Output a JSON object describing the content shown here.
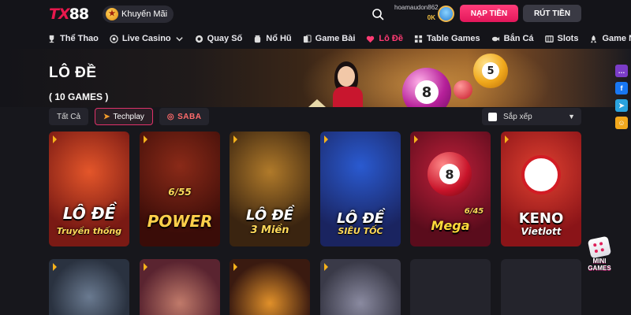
{
  "header": {
    "logo_text_left": "TX",
    "logo_text_right": "88",
    "promo_label": "Khuyến Mãi",
    "username": "hoamaudon862",
    "balance": "0K",
    "deposit_label": "NẠP TIỀN",
    "withdraw_label": "RÚT TIỀN"
  },
  "nav": {
    "items": [
      {
        "label": "Thể Thao",
        "icon": "trophy-icon"
      },
      {
        "label": "Live Casino",
        "icon": "casino-chip-icon"
      },
      {
        "label": "Quay Số",
        "icon": "lottery-ball-icon"
      },
      {
        "label": "Nổ Hũ",
        "icon": "jar-icon"
      },
      {
        "label": "Game Bài",
        "icon": "cards-icon"
      },
      {
        "label": "Lô Đề",
        "icon": "heart-lotto-icon",
        "active": true
      },
      {
        "label": "Table Games",
        "icon": "table-icon"
      },
      {
        "label": "Bắn Cá",
        "icon": "fish-icon"
      },
      {
        "label": "Slots",
        "icon": "slot-machine-icon"
      },
      {
        "label": "Game Nhanh",
        "icon": "rocket-icon"
      }
    ]
  },
  "hero": {
    "title": "LÔ ĐỀ",
    "count": "( 10 GAMES )",
    "balls": [
      "8",
      "5"
    ]
  },
  "filters": {
    "all": "Tất Cả",
    "techplay": "Techplay",
    "saba": "SABA",
    "sort": "Sắp xếp"
  },
  "games": [
    {
      "title": "LÔ ĐỀ",
      "sub": "Truyền thống",
      "bg": "#7a1a14"
    },
    {
      "title": "POWER",
      "sub": "6/55",
      "bg": "#5a1a10"
    },
    {
      "title": "LÔ ĐỀ",
      "sub": "3 Miền",
      "bg": "#3a2410"
    },
    {
      "title": "LÔ ĐỀ",
      "sub": "SIÊU TỐC",
      "bg": "#1a2460"
    },
    {
      "title": "Mega",
      "sub": "6/45",
      "bg": "#5a0c1c"
    },
    {
      "title": "KENO",
      "sub": "Vietlott",
      "bg": "#8a1418"
    },
    {
      "title": "",
      "sub": "",
      "bg": "#2a3240"
    },
    {
      "title": "",
      "sub": "",
      "bg": "#5a2430"
    },
    {
      "title": "",
      "sub": "",
      "bg": "#3a1a10"
    },
    {
      "title": "",
      "sub": "",
      "bg": "#3a3a48"
    }
  ],
  "social": [
    "chat-icon",
    "facebook-icon",
    "telegram-icon",
    "support-icon"
  ],
  "minigames_label": "MINI GAMES",
  "colors": {
    "accent": "#ff3b73",
    "deposit": "#e3175b",
    "background": "#17171c",
    "card_bg": "#24242c"
  }
}
